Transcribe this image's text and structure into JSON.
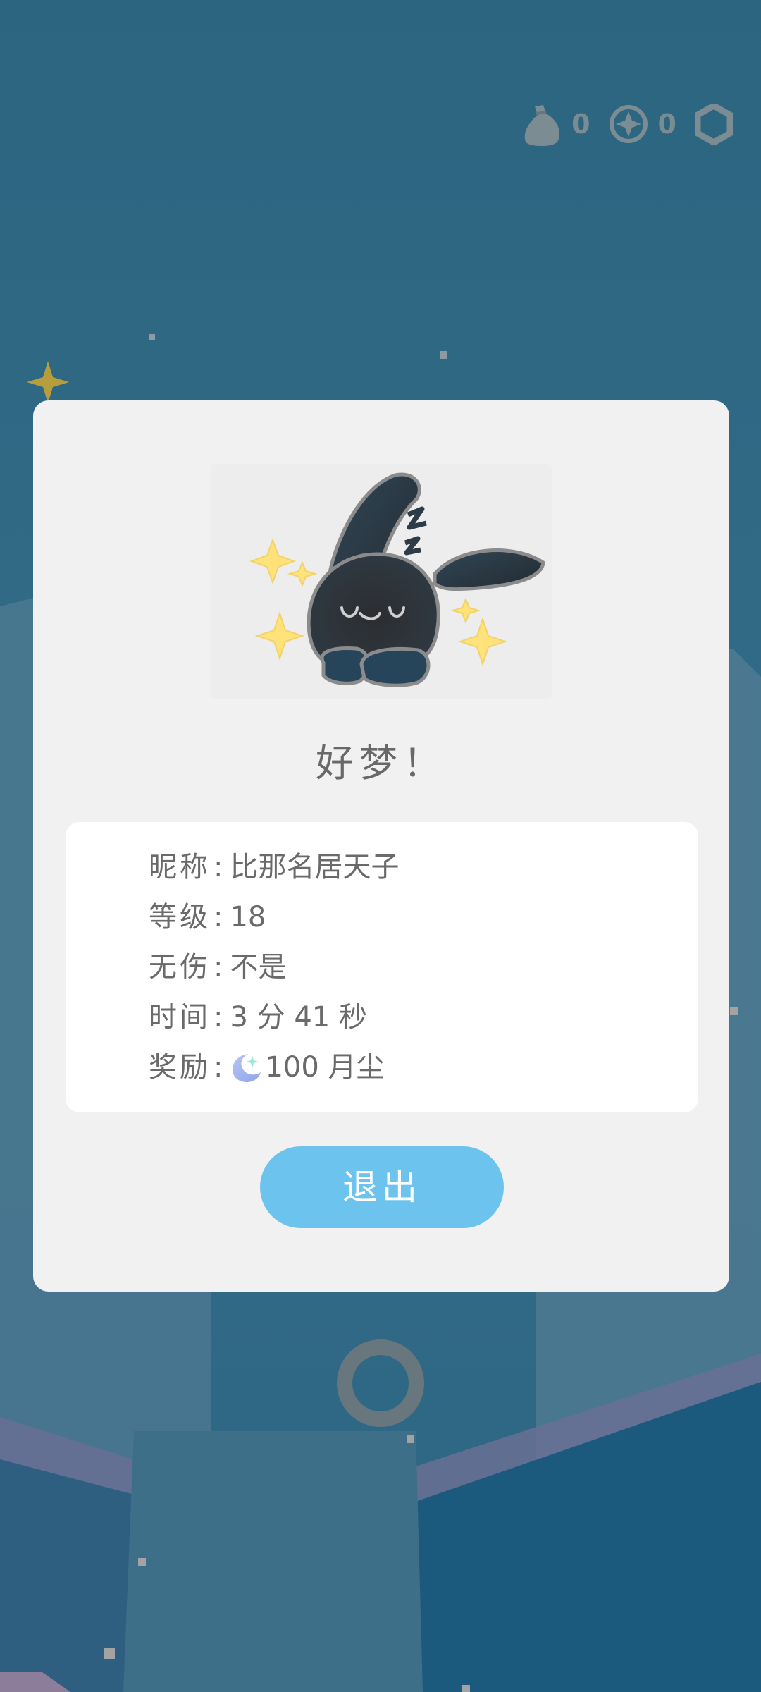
{
  "hud": {
    "bag_count": "0",
    "compass_count": "0",
    "icons": [
      "bag-icon",
      "compass-icon",
      "hexagon-icon"
    ]
  },
  "modal": {
    "title": "好梦！",
    "stats": {
      "nickname_label": "昵称",
      "nickname_value": "比那名居天子",
      "level_label": "等级",
      "level_value": "18",
      "no_damage_label": "无伤",
      "no_damage_value": "不是",
      "time_label": "时间",
      "time_value": "3 分 41 秒",
      "reward_label": "奖励",
      "reward_value": "100 月尘",
      "separator": ":"
    },
    "exit_label": "退出"
  },
  "colors": {
    "sky": "#2a6580",
    "modal_bg": "#f1f1f1",
    "card_bg": "#ffffff",
    "button": "#6cc4ee",
    "text": "#6a6a6a"
  }
}
